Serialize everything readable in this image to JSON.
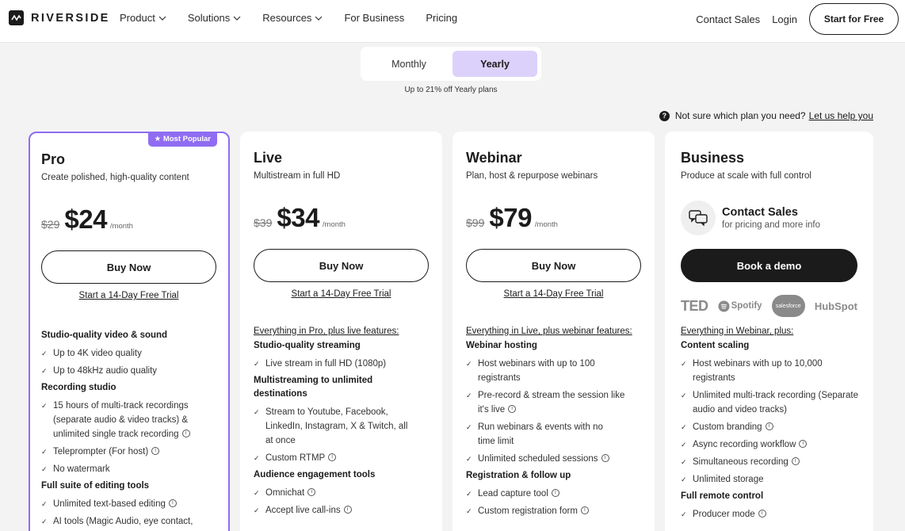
{
  "nav": {
    "brand": "RIVERSIDE",
    "links": [
      "Product",
      "Solutions",
      "Resources",
      "For Business",
      "Pricing"
    ],
    "contact_sales": "Contact Sales",
    "login": "Login",
    "cta": "Start for Free"
  },
  "billing": {
    "monthly": "Monthly",
    "yearly": "Yearly",
    "selected": "Yearly",
    "discount_note": "Up to 21% off Yearly plans"
  },
  "help": {
    "question": "Not sure which plan you need?",
    "link": "Let us help you"
  },
  "plans": [
    {
      "name": "Pro",
      "badge": "★ Most Popular",
      "subtitle": "Create polished, high-quality content",
      "old_price": "$29",
      "price": "$24",
      "per": "/month",
      "button": "Buy Now",
      "trial": "Start a 14-Day Free Trial",
      "features": [
        {
          "section": "Studio-quality video & sound",
          "items": [
            "Up to 4K video quality",
            "Up to 48kHz audio quality"
          ]
        },
        {
          "section": "Recording studio",
          "items": [
            "15 hours of multi-track recordings (separate audio & video tracks) & unlimited single track recording",
            "Teleprompter (For host)",
            "No watermark"
          ]
        },
        {
          "section": "Full suite of editing tools",
          "items": [
            "Unlimited text-based editing",
            "AI tools (Magic Audio, eye contact,"
          ]
        }
      ]
    },
    {
      "name": "Live",
      "subtitle": "Multistream in full HD",
      "old_price": "$39",
      "price": "$34",
      "per": "/month",
      "button": "Buy Now",
      "trial": "Start a 14-Day Free Trial",
      "intro": "Everything in Pro, plus live features:",
      "features": [
        {
          "section": "Studio-quality streaming",
          "items": [
            "Live stream in full HD (1080p)"
          ]
        },
        {
          "section": "Multistreaming to unlimited destinations",
          "items": [
            "Stream to Youtube, Facebook, LinkedIn, Instagram, X & Twitch, all at once",
            "Custom RTMP"
          ]
        },
        {
          "section": "Audience engagement tools",
          "items": [
            "Omnichat",
            "Accept live call-ins"
          ]
        }
      ]
    },
    {
      "name": "Webinar",
      "subtitle": "Plan, host & repurpose webinars",
      "old_price": "$99",
      "price": "$79",
      "per": "/month",
      "button": "Buy Now",
      "trial": "Start a 14-Day Free Trial",
      "intro": "Everything in Live, plus webinar features:",
      "features": [
        {
          "section": "Webinar hosting",
          "items": [
            "Host webinars with up to 100 registrants",
            "Pre-record & stream the session like it's live",
            "Run webinars & events with no time limit",
            "Unlimited scheduled sessions"
          ]
        },
        {
          "section": "Registration & follow up",
          "items": [
            "Lead capture tool",
            "Custom registration form"
          ]
        }
      ]
    },
    {
      "name": "Business",
      "subtitle": "Produce at scale with full control",
      "contact_title": "Contact Sales",
      "contact_sub": "for pricing and more info",
      "button": "Book a demo",
      "logos": [
        "TED",
        "Spotify",
        "salesforce",
        "HubSpot"
      ],
      "intro": "Everything in Webinar, plus:",
      "features": [
        {
          "section": "Content scaling",
          "items": [
            "Host webinars with up to 10,000 registrants",
            "Unlimited multi-track recording (Separate audio and video tracks)",
            "Custom branding",
            "Async recording workflow",
            "Simultaneous recording",
            "Unlimited storage"
          ]
        },
        {
          "section": "Full remote control",
          "items": [
            "Producer mode"
          ]
        }
      ]
    }
  ],
  "colors": {
    "accent": "#8f6cf2",
    "toggle_selected": "#dcd1fb",
    "background": "#f3f3f3",
    "dark": "#1b1b1b"
  }
}
